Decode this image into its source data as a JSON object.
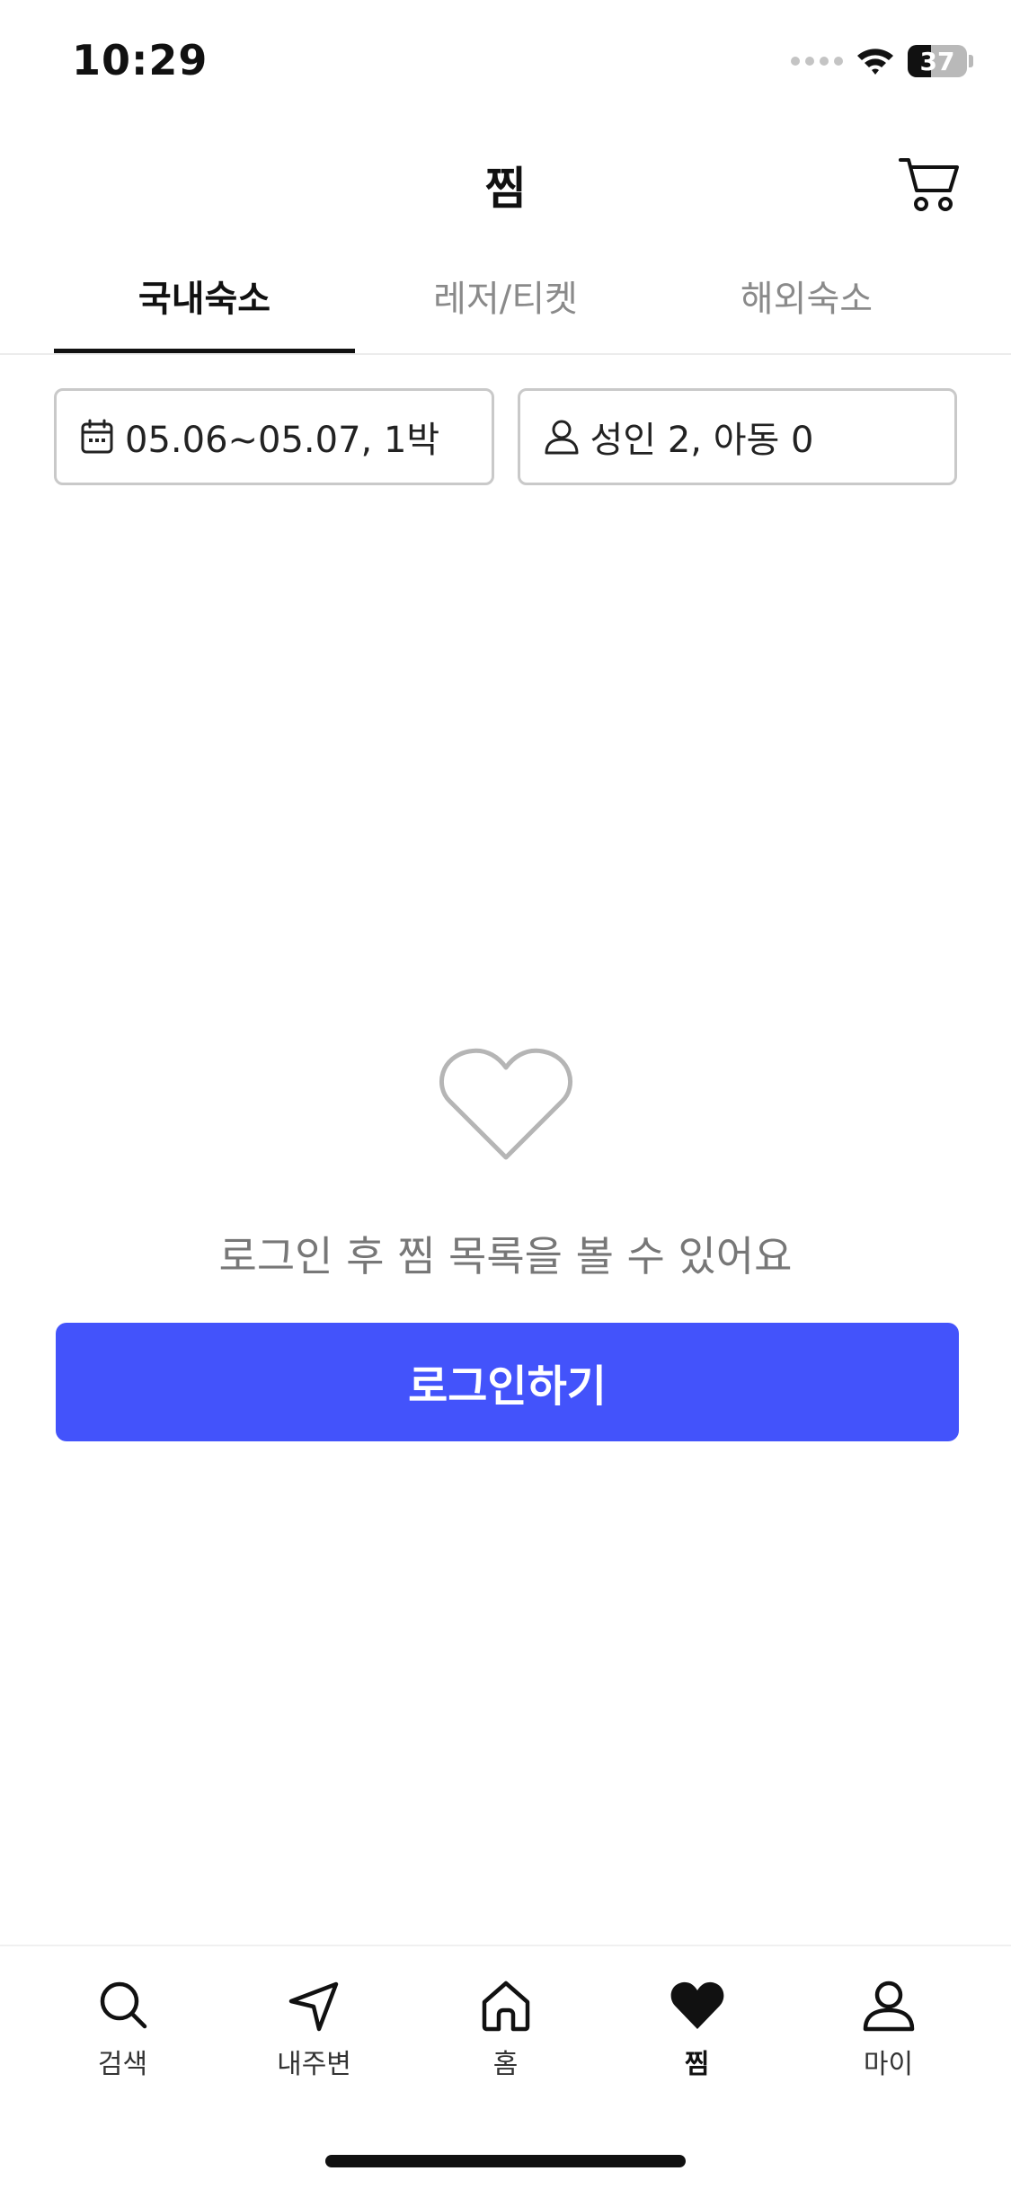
{
  "status_bar": {
    "time": "10:29",
    "battery": "37",
    "signal_icon": "cellular-dots-icon",
    "wifi_icon": "wifi-icon"
  },
  "header": {
    "title": "찜",
    "cart_icon": "cart-icon"
  },
  "tabs": [
    {
      "label": "국내숙소",
      "active": true
    },
    {
      "label": "레저/티켓",
      "active": false
    },
    {
      "label": "해외숙소",
      "active": false
    }
  ],
  "filters": {
    "date": {
      "label": "05.06~05.07, 1박",
      "icon": "calendar-icon"
    },
    "guests": {
      "label": "성인 2, 아동 0",
      "icon": "person-icon"
    }
  },
  "empty_state": {
    "icon": "heart-outline-icon",
    "message": "로그인 후 찜 목록을 볼 수 있어요",
    "button_label": "로그인하기"
  },
  "bottom_nav": [
    {
      "label": "검색",
      "icon": "search-icon",
      "active": false
    },
    {
      "label": "내주변",
      "icon": "navigation-arrow-icon",
      "active": false
    },
    {
      "label": "홈",
      "icon": "home-icon",
      "active": false
    },
    {
      "label": "찜",
      "icon": "heart-filled-icon",
      "active": true
    },
    {
      "label": "마이",
      "icon": "user-icon",
      "active": false
    }
  ],
  "colors": {
    "primary": "#4353fb",
    "text": "#111111",
    "muted": "#8a8a8a",
    "border": "#c9c9c9"
  }
}
